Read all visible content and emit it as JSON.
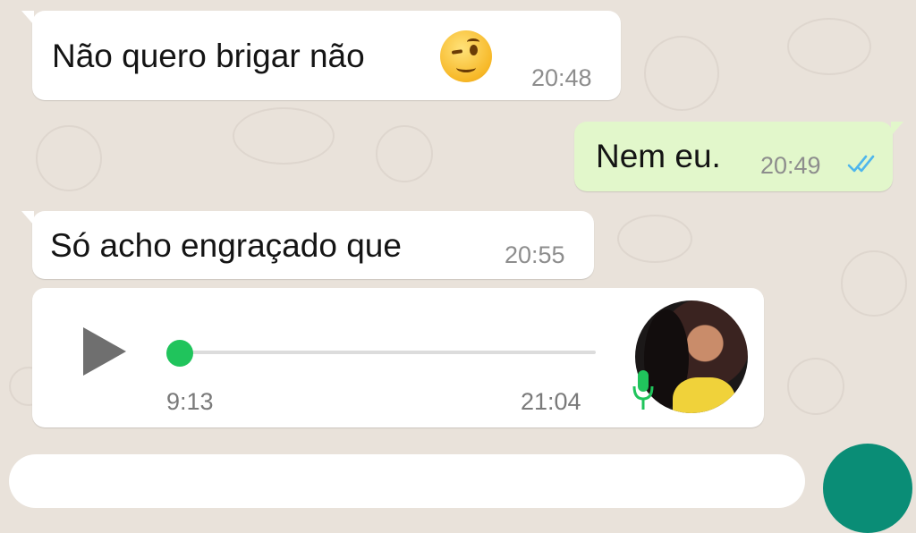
{
  "colors": {
    "wallpaper": "#e9e2da",
    "incoming_bubble": "#ffffff",
    "outgoing_bubble": "#e2f7cb",
    "read_ticks": "#4fb6ec",
    "audio_accent": "#20c45c",
    "send_button": "#0a8d76"
  },
  "messages": [
    {
      "direction": "incoming",
      "text": "Não quero brigar não",
      "emoji": "smirking-face",
      "time": "20:48"
    },
    {
      "direction": "outgoing",
      "text": "Nem eu.",
      "time": "20:49",
      "status": "read-double-check"
    },
    {
      "direction": "incoming",
      "text": "Só acho engraçado que",
      "time": "20:55"
    }
  ],
  "audio_message": {
    "duration": "9:13",
    "time": "21:04",
    "progress": 0,
    "icons": [
      "play-icon",
      "microphone-icon",
      "sender-avatar"
    ]
  }
}
